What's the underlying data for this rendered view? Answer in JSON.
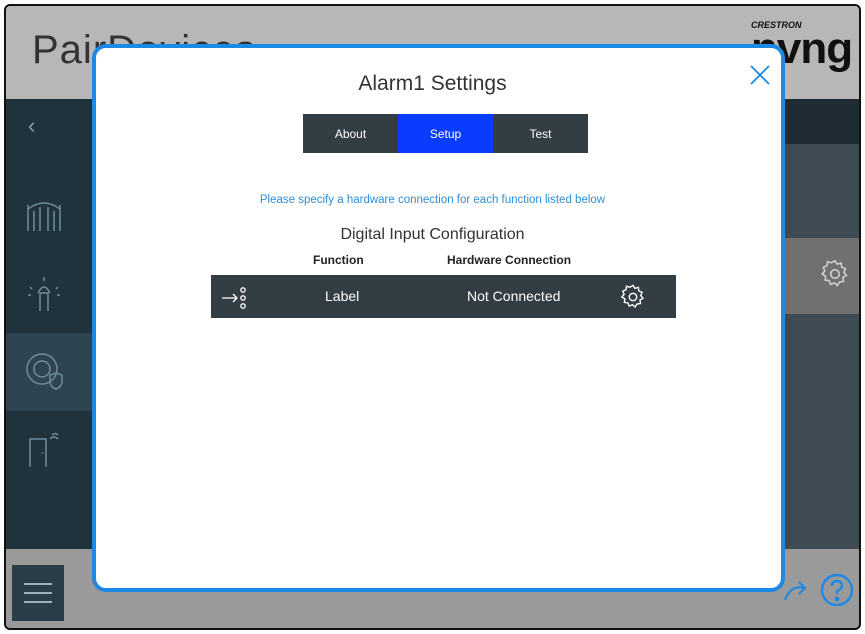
{
  "app": {
    "title": "PairDevices",
    "brand_small": "CRESTRON",
    "brand_big": "nvng"
  },
  "modal": {
    "title": "Alarm1 Settings",
    "tabs": [
      {
        "label": "About",
        "active": false
      },
      {
        "label": "Setup",
        "active": true
      },
      {
        "label": "Test",
        "active": false
      }
    ],
    "instruction": "Please specify a hardware connection for each function listed below",
    "section_title": "Digital Input Configuration",
    "columns": {
      "function": "Function",
      "hardware": "Hardware Connection"
    },
    "rows": [
      {
        "function": "Label",
        "hardware": "Not Connected"
      }
    ]
  },
  "colors": {
    "accent": "#1e88e5",
    "tab_active": "#0a3cff",
    "row_bg": "#333d44",
    "instruction_text": "#2d8fd8"
  },
  "icons": [
    "close-icon",
    "gear-icon",
    "input-arrow-icon",
    "back-chevron-icon",
    "gate-icon",
    "sprinkler-icon",
    "security-icon",
    "door-sensor-icon",
    "menu-icon",
    "help-icon",
    "share-icon"
  ]
}
